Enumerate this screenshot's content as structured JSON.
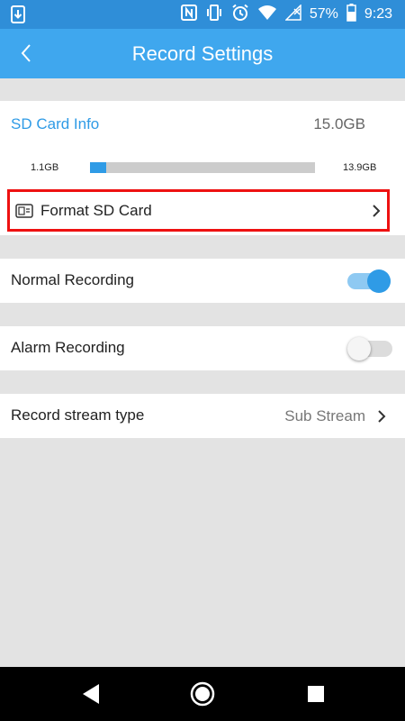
{
  "status_bar": {
    "battery_percent": "57%",
    "time": "9:23",
    "icons": [
      "download-icon",
      "nfc-icon",
      "vibrate-icon",
      "alarm-icon",
      "wifi-icon",
      "signal-icon",
      "battery-icon"
    ]
  },
  "app_bar": {
    "title": "Record Settings",
    "back_icon": "back-chevron-icon"
  },
  "sd_card": {
    "title": "SD Card Info",
    "total": "15.0GB",
    "used": "1.1GB",
    "free": "13.9GB",
    "used_fraction": 0.073,
    "format_label": "Format SD Card",
    "format_icon": "sd-card-icon"
  },
  "normal_recording": {
    "label": "Normal Recording",
    "enabled": true
  },
  "alarm_recording": {
    "label": "Alarm Recording",
    "enabled": false
  },
  "stream_type": {
    "label": "Record stream type",
    "value": "Sub Stream"
  },
  "colors": {
    "app_bar": "#3fa7ee",
    "status_bar": "#2f8ed8",
    "accent": "#2f9be6",
    "highlight_border": "#ee1111",
    "background": "#e3e3e3"
  },
  "nav_bar": {
    "buttons": [
      "back-triangle-icon",
      "home-circle-icon",
      "recents-square-icon"
    ]
  }
}
